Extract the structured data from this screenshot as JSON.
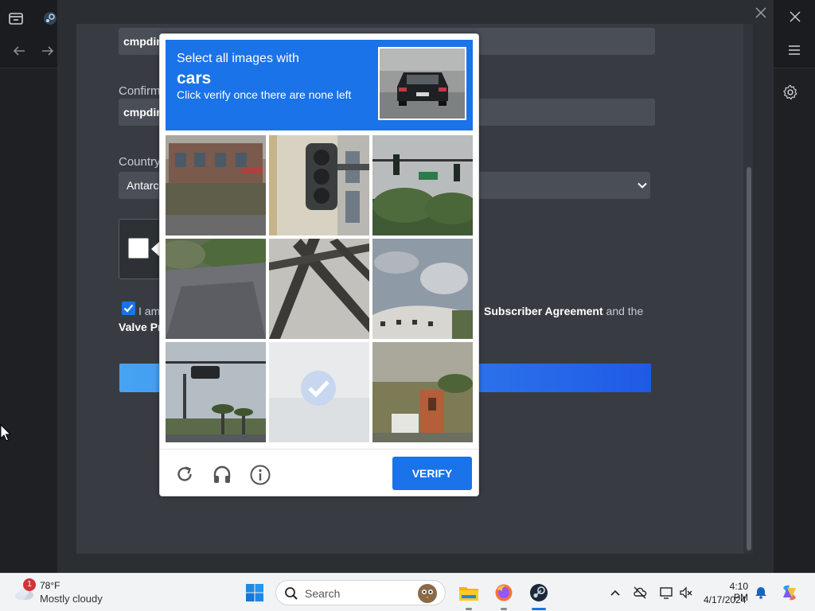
{
  "steam_form": {
    "email_value": "cmpdir",
    "confirm_label": "Confirm",
    "confirm_value": "cmpdir",
    "country_label": "Country",
    "country_value": "Antarc",
    "agree_prefix": "I am",
    "agree_link1": "Subscriber Agreement",
    "agree_connector": "and the",
    "agree_link2": "Valve Pr"
  },
  "captcha": {
    "prompt_line1": "Select all images with",
    "prompt_target": "cars",
    "prompt_line3": "Click verify once there are none left",
    "verify_label": "VERIFY",
    "tiles": [
      {
        "name": "building-street",
        "selected": false
      },
      {
        "name": "traffic-light-closeup",
        "selected": false
      },
      {
        "name": "traffic-signal-trees",
        "selected": false
      },
      {
        "name": "dirt-path",
        "selected": false
      },
      {
        "name": "bridge-truss",
        "selected": false
      },
      {
        "name": "building-clouds",
        "selected": false
      },
      {
        "name": "traffic-light-palms",
        "selected": false
      },
      {
        "name": "selected-tile",
        "selected": true
      },
      {
        "name": "brick-sign",
        "selected": false
      }
    ]
  },
  "taskbar": {
    "weather_badge": "1",
    "weather_temp": "78°F",
    "weather_cond": "Mostly cloudy",
    "search_placeholder": "Search",
    "clock_time": "4:10 PM",
    "clock_date": "4/17/2024"
  },
  "colors": {
    "accent": "#1a73e8",
    "dialog_bg": "#2b2e33",
    "taskbar_bg": "#f2f3f5"
  }
}
